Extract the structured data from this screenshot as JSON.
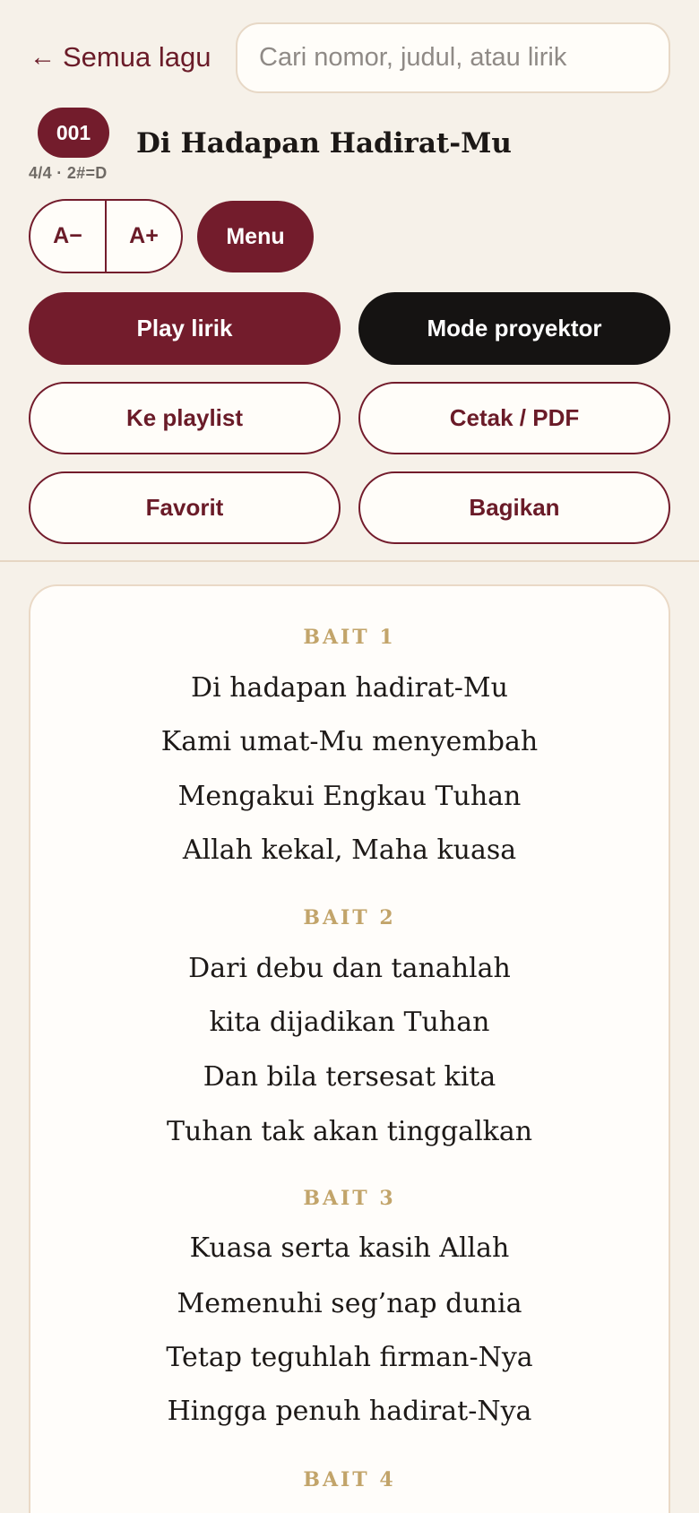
{
  "header": {
    "back_label": "Semua lagu",
    "back_arrow": "←",
    "search_placeholder": "Cari nomor, judul, atau lirik",
    "search_value": ""
  },
  "song": {
    "number": "001",
    "meta": "4/4 · 2#=D",
    "title": "Di Hadapan Hadirat-Mu"
  },
  "controls": {
    "zoom_out": "A−",
    "zoom_in": "A+",
    "menu": "Menu"
  },
  "actions": {
    "play": "Play lirik",
    "projector": "Mode proyektor",
    "playlist": "Ke playlist",
    "print": "Cetak / PDF",
    "favorite": "Favorit",
    "share": "Bagikan"
  },
  "lyrics": [
    {
      "label": "BAIT 1",
      "lines": [
        "Di hadapan hadirat-Mu",
        "Kami umat-Mu menyembah",
        "Mengakui Engkau Tuhan",
        "Allah kekal, Maha kuasa"
      ]
    },
    {
      "label": "BAIT 2",
      "lines": [
        "Dari debu dan tanahlah",
        "kita dijadikan Tuhan",
        "Dan bila tersesat kita",
        "Tuhan tak akan tinggalkan"
      ]
    },
    {
      "label": "BAIT 3",
      "lines": [
        "Kuasa serta kasih Allah",
        "Memenuhi seg’nap dunia",
        "Tetap teguhlah firman-Nya",
        "Hingga penuh hadirat-Nya"
      ]
    },
    {
      "label": "BAIT 4",
      "lines": []
    }
  ],
  "colors": {
    "accent": "#731c2c",
    "background": "#f6f1e9",
    "verse_label": "#c2a46a"
  }
}
